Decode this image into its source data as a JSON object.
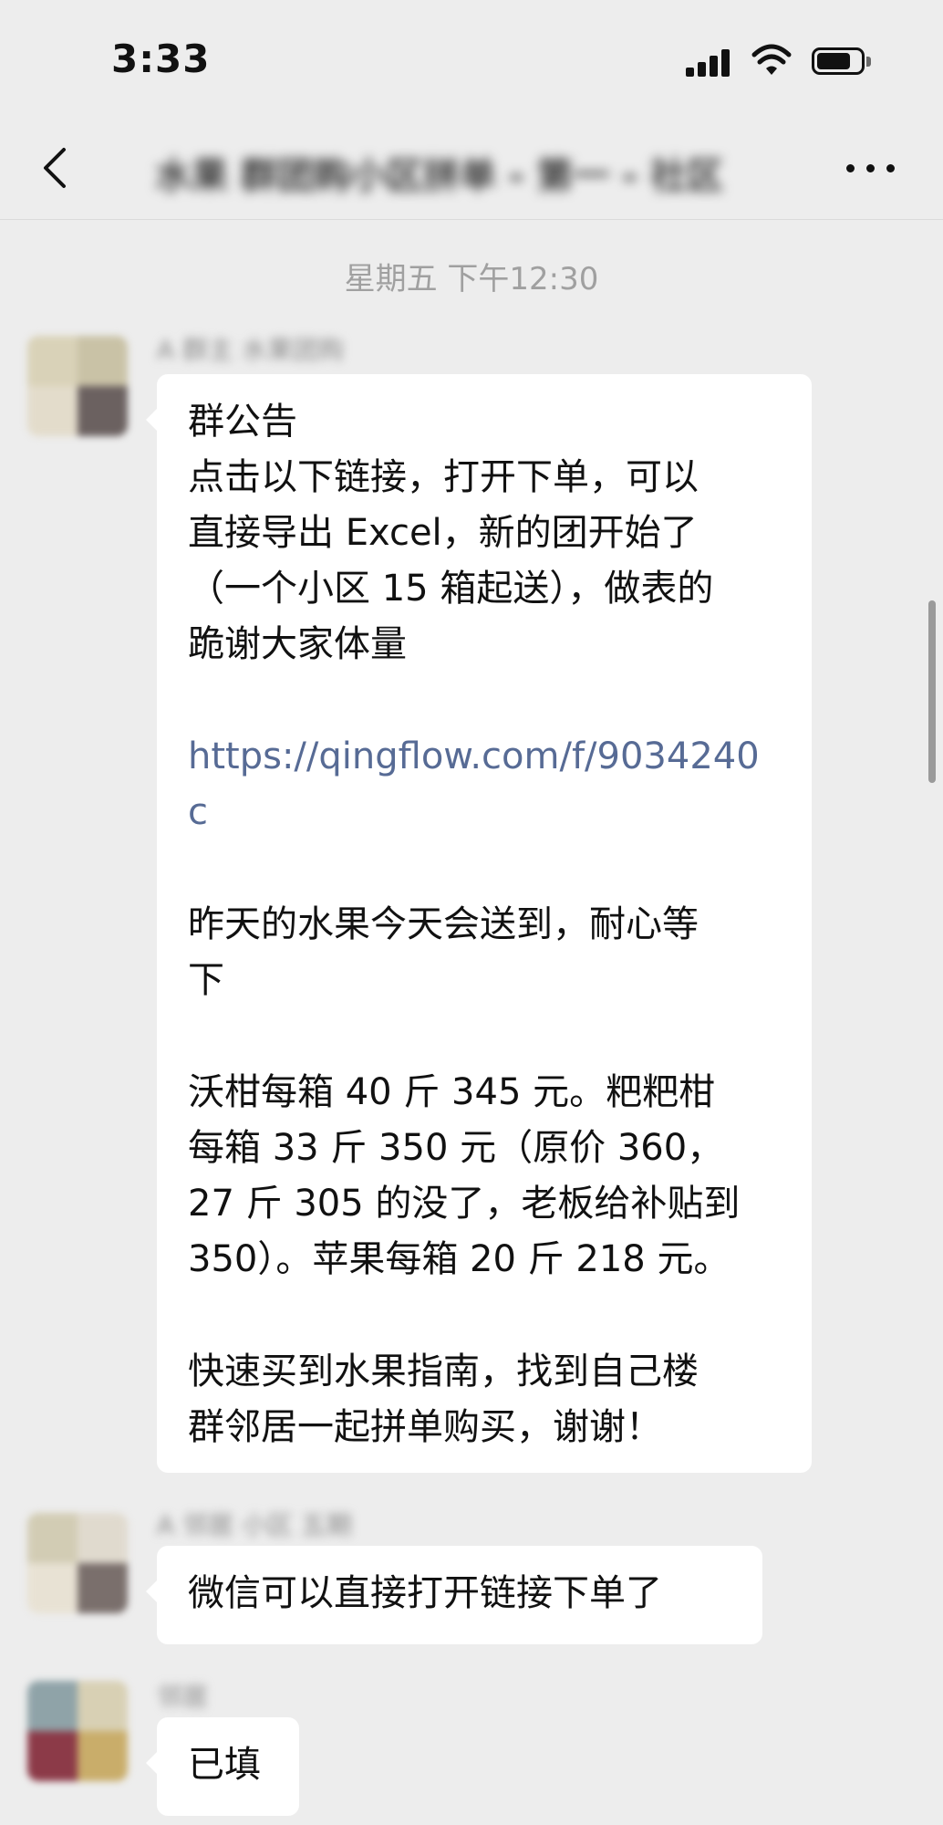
{
  "status_bar": {
    "time": "3:33"
  },
  "nav": {
    "title": "水果 群团购小区拼单 - 第一 - 社区"
  },
  "timestamp": "星期五 下午12:30",
  "messages": [
    {
      "sender": "A 群主 水果团购",
      "lines_a": [
        "群公告",
        "点击以下链接，打开下单，可以",
        "直接导出 Excel，新的团开始了",
        "（一个小区 15 箱起送），做表的",
        "跪谢大家体量"
      ],
      "link_lines": [
        "https://qingflow.com/f/9034240",
        "c"
      ],
      "lines_b": [
        "昨天的水果今天会送到，耐心等",
        "下"
      ],
      "lines_c": [
        "沃柑每箱 40 斤 345 元。粑粑柑",
        "每箱 33 斤 350 元（原价 360，",
        "27 斤 305 的没了，老板给补贴到",
        "350）。苹果每箱 20 斤 218 元。"
      ],
      "lines_d": [
        "快速买到水果指南，找到自己楼",
        "群邻居一起拼单购买，谢谢！"
      ]
    },
    {
      "sender": "A 邻居 小区 五期",
      "text": "微信可以直接打开链接下单了"
    },
    {
      "sender": "邻居",
      "text": "已填"
    }
  ],
  "icons": [
    "back-icon",
    "more-icon",
    "signal-icon",
    "wifi-icon",
    "battery-icon"
  ],
  "colors": {
    "background": "#ededed",
    "bubble": "#ffffff",
    "link": "#576b95",
    "timestamp": "#a0a0a0"
  }
}
